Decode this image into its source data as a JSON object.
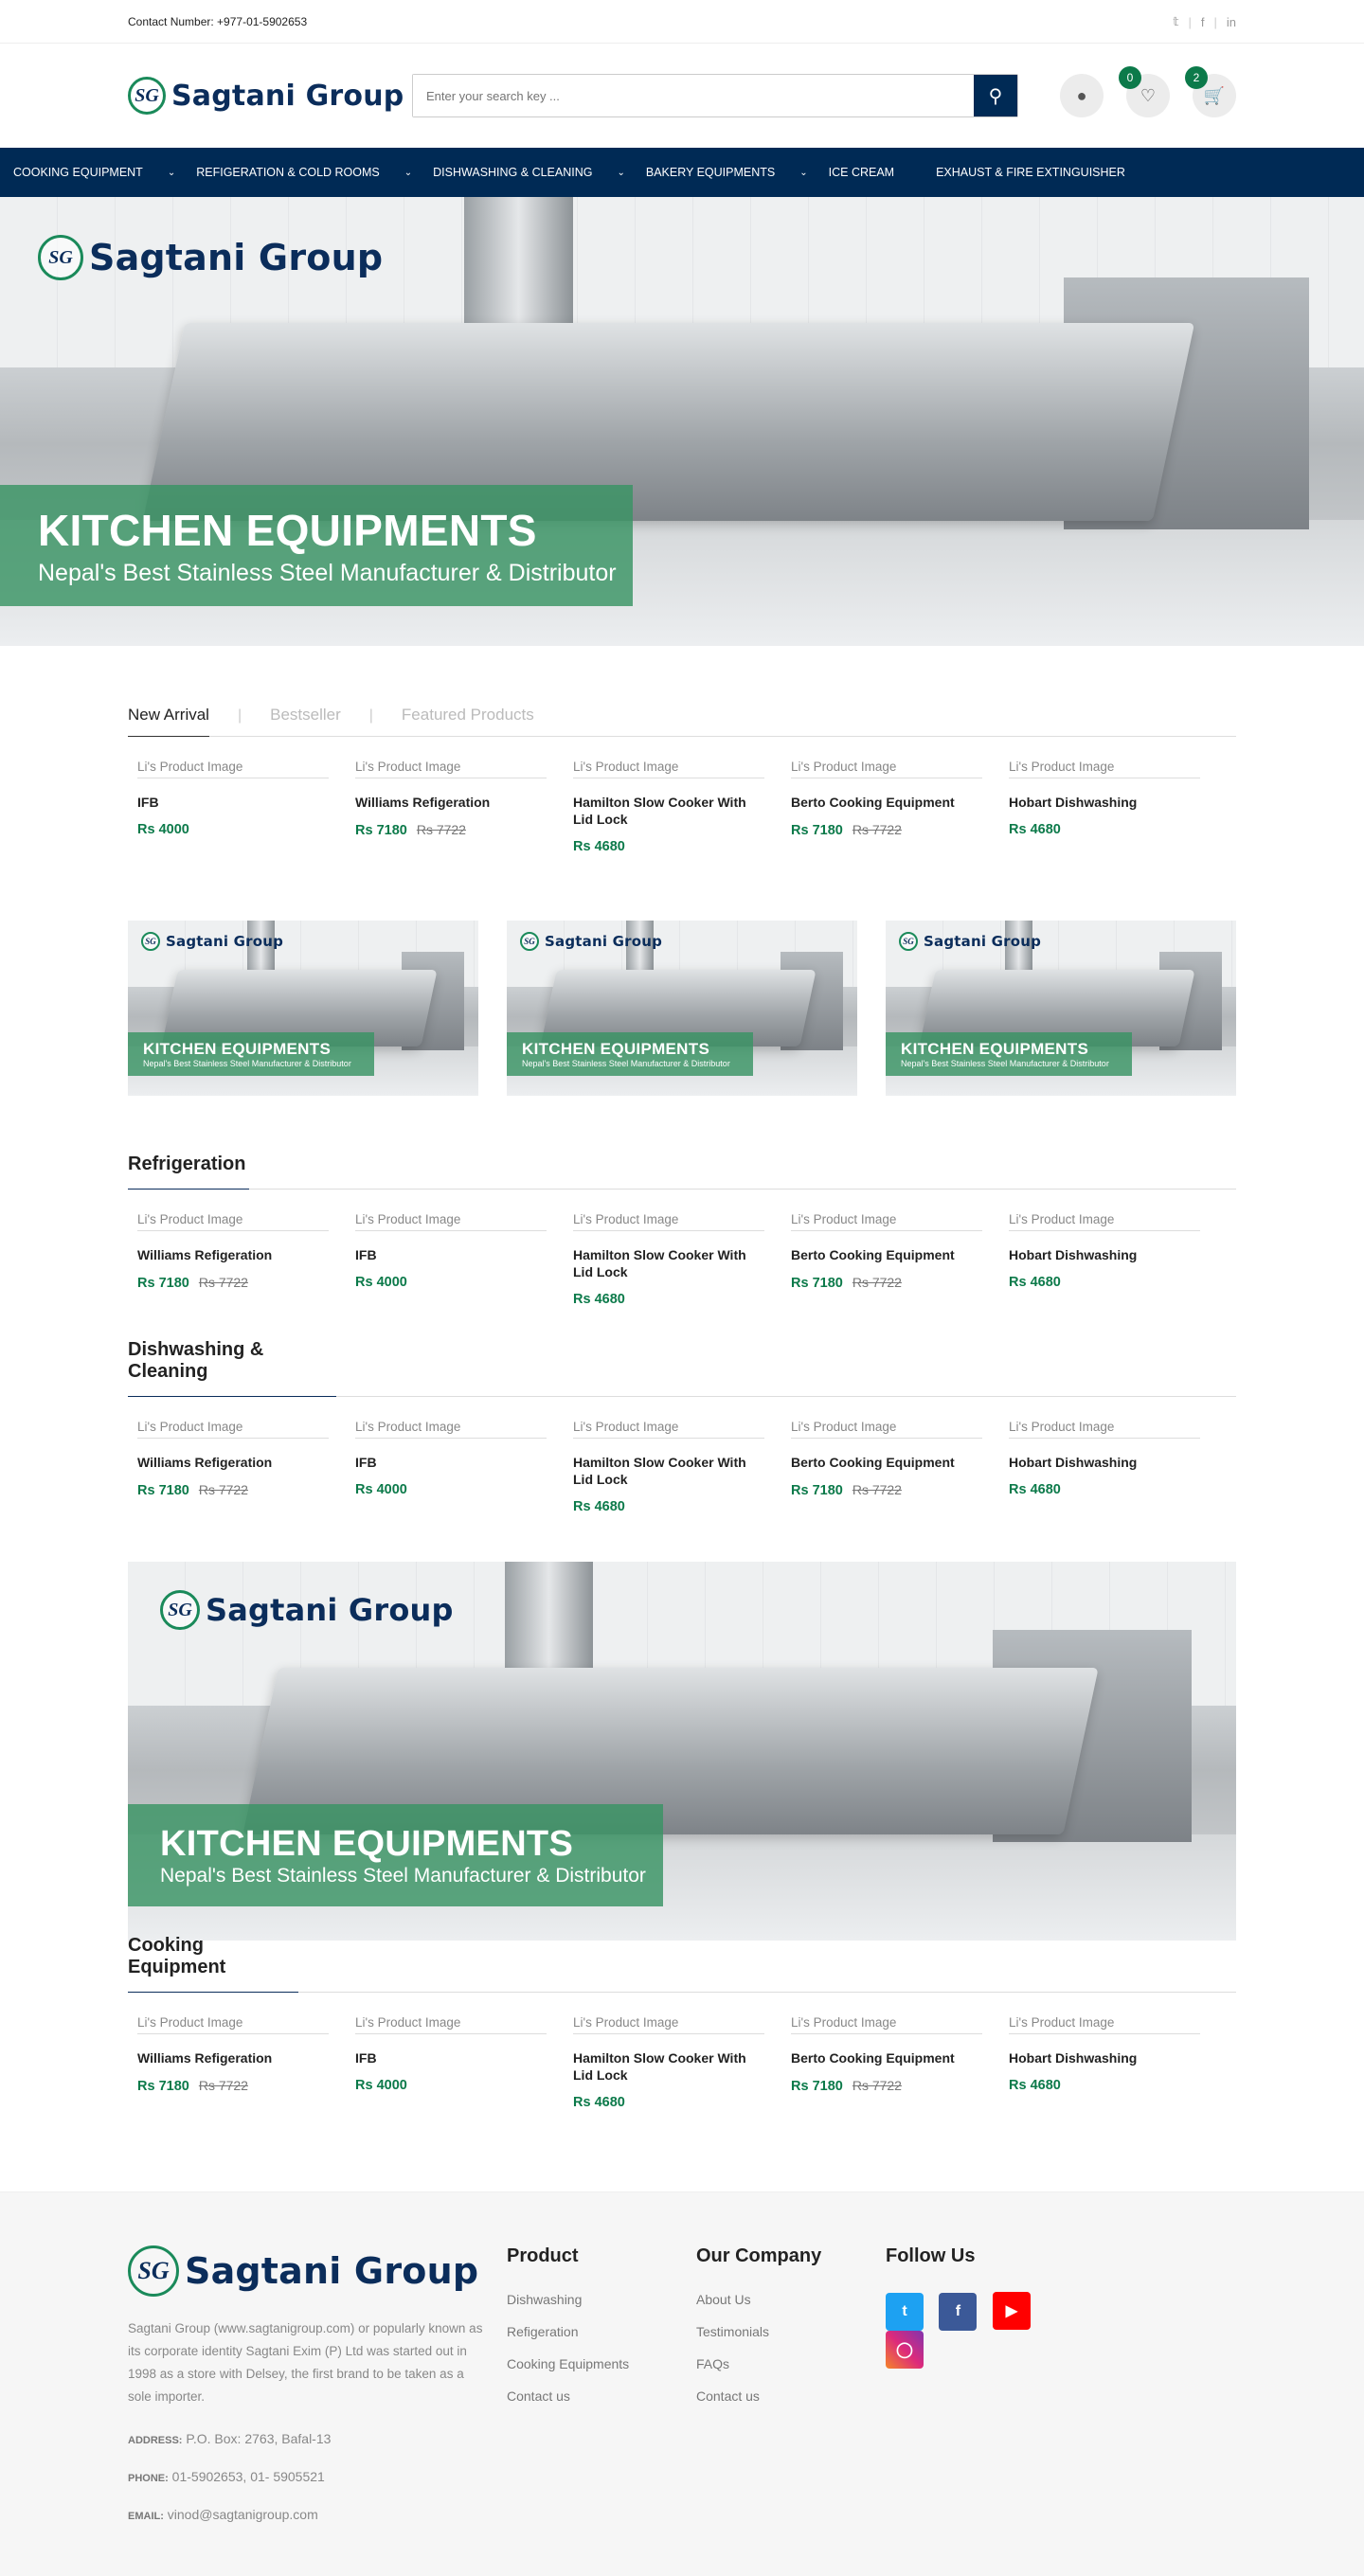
{
  "topbar": {
    "contact": "Contact Number: +977-01-5902653"
  },
  "brand": {
    "name": "Sagtani Group",
    "mark": "SG"
  },
  "search": {
    "placeholder": "Enter your search key ..."
  },
  "header": {
    "wishlist_count": "0",
    "cart_count": "2"
  },
  "nav": [
    {
      "label": "COOKING EQUIPMENT",
      "dropdown": true
    },
    {
      "label": "REFIGERATION & COLD ROOMS",
      "dropdown": true
    },
    {
      "label": "DISHWASHING & CLEANING",
      "dropdown": true
    },
    {
      "label": "BAKERY EQUIPMENTS",
      "dropdown": true
    },
    {
      "label": "ICE CREAM",
      "dropdown": false
    },
    {
      "label": "EXHAUST & FIRE EXTINGUISHER",
      "dropdown": false
    }
  ],
  "hero": {
    "logo_text": "Sagtani Group",
    "title": "KITCHEN EQUIPMENTS",
    "subtitle": "Nepal's Best Stainless Steel Manufacturer & Distributor"
  },
  "tabs": {
    "new_arrival": "New Arrival",
    "bestseller": "Bestseller",
    "featured": "Featured Products"
  },
  "img_alt": "Li's Product Image",
  "currency": "Rs",
  "new_arrivals": [
    {
      "name": "IFB",
      "price": "Rs 4000",
      "old": ""
    },
    {
      "name": "Williams Refigeration",
      "price": "Rs 7180",
      "old": "Rs 7722"
    },
    {
      "name": "Hamilton Slow Cooker With Lid Lock",
      "price": "Rs 4680",
      "old": ""
    },
    {
      "name": "Berto Cooking Equipment",
      "price": "Rs 7180",
      "old": "Rs 7722"
    },
    {
      "name": "Hobart Dishwashing",
      "price": "Rs 4680",
      "old": ""
    }
  ],
  "sections": {
    "refrigeration": "Refrigeration",
    "dishwashing": "Dishwashing & Cleaning",
    "cooking": "Cooking Equipment"
  },
  "section_products": [
    {
      "name": "Williams Refigeration",
      "price": "Rs 7180",
      "old": "Rs 7722"
    },
    {
      "name": "IFB",
      "price": "Rs 4000",
      "old": ""
    },
    {
      "name": "Hamilton Slow Cooker With Lid Lock",
      "price": "Rs 4680",
      "old": ""
    },
    {
      "name": "Berto Cooking Equipment",
      "price": "Rs 7180",
      "old": "Rs 7722"
    },
    {
      "name": "Hobart Dishwashing",
      "price": "Rs 4680",
      "old": ""
    }
  ],
  "footer": {
    "desc": "Sagtani Group (www.sagtanigroup.com) or popularly known as its corporate identity Sagtani Exim (P) Ltd was started out in 1998 as a store with Delsey, the first brand to be taken as a sole importer.",
    "address_label": "ADDRESS:",
    "address": "P.O. Box: 2763, Bafal-13",
    "phone_label": "PHONE:",
    "phone": "01-5902653, 01- 5905521",
    "email_label": "EMAIL:",
    "email": "vinod@sagtanigroup.com",
    "product_title": "Product",
    "product_links": [
      "Dishwashing",
      "Refigeration",
      "Cooking Equipments",
      "Contact us"
    ],
    "company_title": "Our Company",
    "company_links": [
      "About Us",
      "Testimonials",
      "FAQs",
      "Contact us"
    ],
    "follow_title": "Follow Us",
    "social_colors": {
      "twitter": "#1da1f2",
      "facebook": "#3b5998",
      "youtube": "#ff0000",
      "instagram": "#c13584"
    }
  }
}
